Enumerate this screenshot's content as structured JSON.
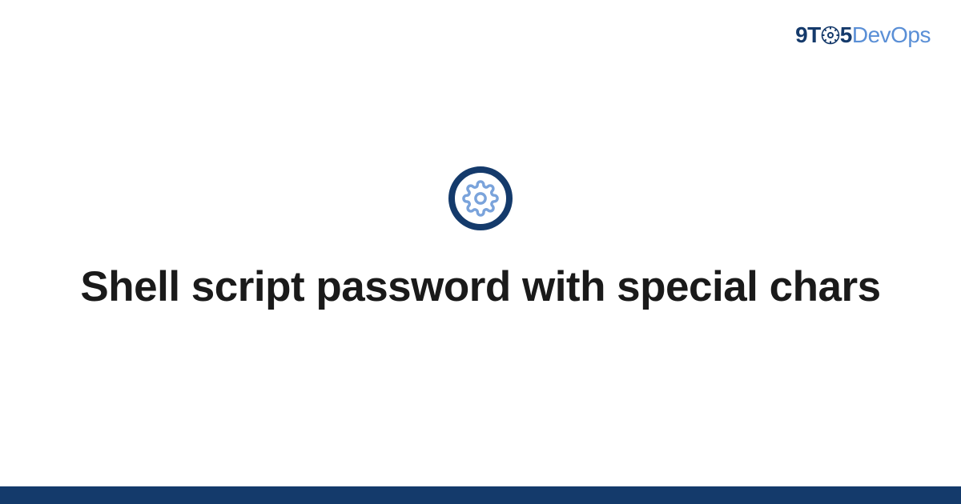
{
  "brand": {
    "part1": "9T",
    "part2": "5",
    "part3": "DevOps"
  },
  "title": "Shell script password with special chars",
  "colors": {
    "primary_dark": "#143a6b",
    "primary_light": "#5a8fd6",
    "gear_stroke": "#7aa3db"
  }
}
